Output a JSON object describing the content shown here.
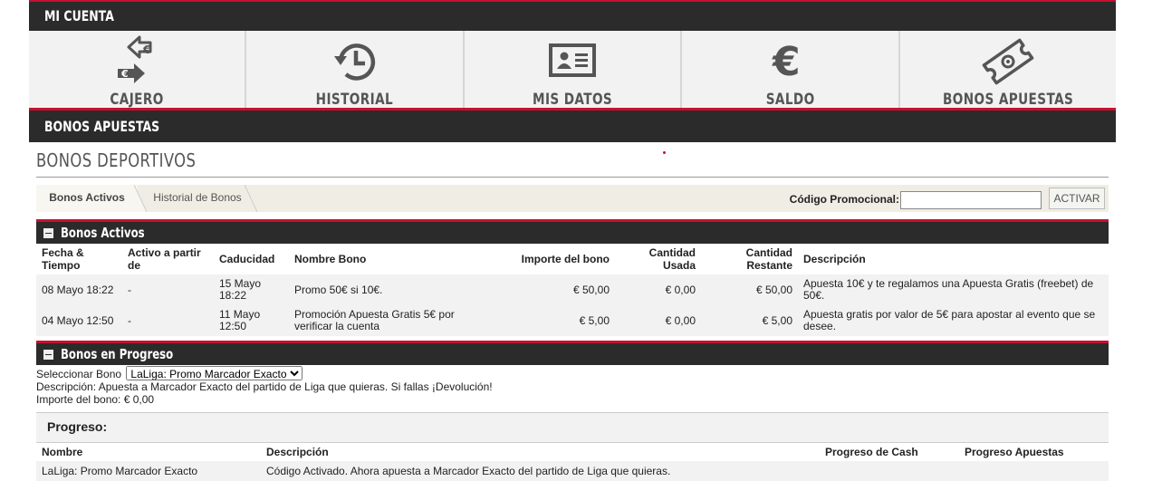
{
  "header": {
    "title": "MI CUENTA"
  },
  "nav": [
    {
      "label": "CAJERO",
      "icon": "exchange-euro-icon"
    },
    {
      "label": "HISTORIAL",
      "icon": "history-icon"
    },
    {
      "label": "MIS DATOS",
      "icon": "id-card-icon"
    },
    {
      "label": "SALDO",
      "icon": "euro-icon"
    },
    {
      "label": "BONOS APUESTAS",
      "icon": "ticket-icon"
    }
  ],
  "section_header": "BONOS APUESTAS",
  "page_title": "BONOS DEPORTIVOS",
  "tabs": [
    {
      "label": "Bonos Activos",
      "active": true
    },
    {
      "label": "Historial de Bonos",
      "active": false
    }
  ],
  "promo": {
    "label": "Código Promocional:",
    "value": "",
    "button": "ACTIVAR"
  },
  "active_bonuses": {
    "title": "Bonos Activos",
    "columns": [
      "Fecha & Tiempo",
      "Activo a partir de",
      "Caducidad",
      "Nombre Bono",
      "Importe del bono",
      "Cantidad Usada",
      "Cantidad Restante",
      "Descripción"
    ],
    "rows": [
      {
        "fecha": "08 Mayo 18:22",
        "activo": "-",
        "caducidad": "15 Mayo 18:22",
        "nombre": "Promo 50€ si 10€.",
        "importe": "€ 50,00",
        "usada": "€ 0,00",
        "restante": "€ 50,00",
        "descripcion": "Apuesta 10€ y te regalamos una Apuesta Gratis (freebet) de 50€."
      },
      {
        "fecha": "04 Mayo 12:50",
        "activo": "-",
        "caducidad": "11 Mayo 12:50",
        "nombre": "Promoción Apuesta Gratis 5€ por verificar la cuenta",
        "importe": "€ 5,00",
        "usada": "€ 0,00",
        "restante": "€ 5,00",
        "descripcion": "Apuesta gratis por valor de 5€ para apostar al evento que se desee."
      }
    ]
  },
  "progress_bonuses": {
    "title": "Bonos en Progreso",
    "select_label": "Seleccionar Bono",
    "selected": "LaLiga: Promo Marcador Exacto",
    "description": "Descripción: Apuesta a Marcador Exacto del partido de Liga que quieras. Si fallas ¡Devolución!",
    "amount": "Importe del bono: € 0,00",
    "progress_title": "Progreso:",
    "columns": [
      "Nombre",
      "Descripción",
      "Progreso de Cash",
      "Progreso Apuestas"
    ],
    "rows": [
      {
        "nombre": "LaLiga: Promo Marcador Exacto",
        "descripcion": "Código Activado. Ahora apuesta a Marcador Exacto del partido de Liga que quieras.",
        "cash": "",
        "apuestas": ""
      }
    ]
  },
  "colors": {
    "accent": "#c8102e",
    "dark": "#2b2b2b",
    "light": "#f2f2f2"
  }
}
